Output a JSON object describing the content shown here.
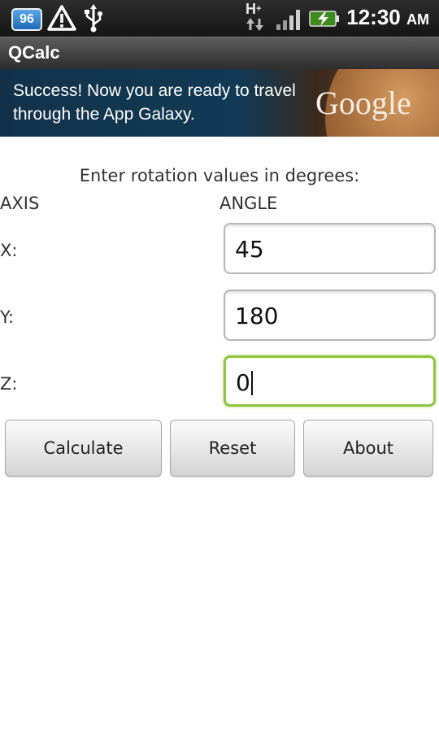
{
  "status_bar": {
    "notification_badge": "96",
    "network_type": "H",
    "network_plus": "+",
    "time": "12:30",
    "ampm": "AM",
    "icons": [
      "notification-badge-icon",
      "warning-icon",
      "usb-icon",
      "data-arrows-icon",
      "signal-icon",
      "battery-charging-icon"
    ]
  },
  "app": {
    "title": "QCalc"
  },
  "ad": {
    "text": "Success! Now you are ready to travel through the App Galaxy.",
    "logo": "Google"
  },
  "form": {
    "prompt": "Enter rotation values in degrees:",
    "axis_header": "AXIS",
    "angle_header": "ANGLE",
    "rows": [
      {
        "axis": "X:",
        "value": "45"
      },
      {
        "axis": "Y:",
        "value": "180"
      },
      {
        "axis": "Z:",
        "value": "0",
        "focused": true
      }
    ]
  },
  "buttons": {
    "calculate": "Calculate",
    "reset": "Reset",
    "about": "About"
  },
  "colors": {
    "focus_border": "#8ec63f",
    "titlebar": "#3a3a3a"
  }
}
